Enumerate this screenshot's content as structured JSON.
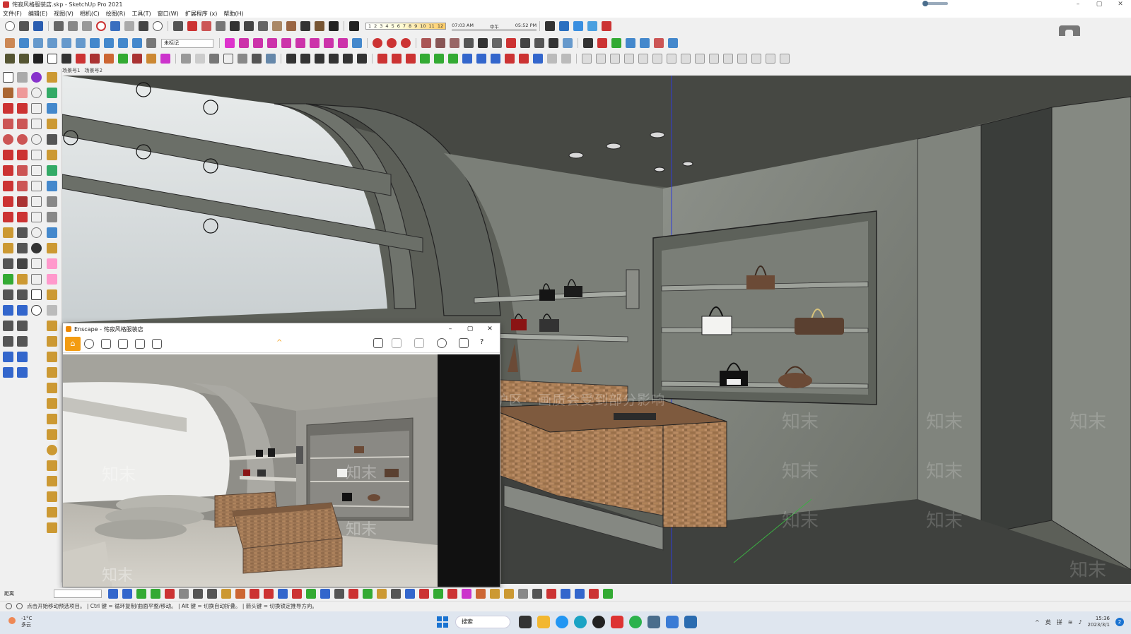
{
  "window": {
    "title": "侘寂风格服装店.skp - SketchUp Pro 2021",
    "controls": [
      "–",
      "▢",
      "✕"
    ]
  },
  "menu": [
    "文件(F)",
    "编辑(E)",
    "视图(V)",
    "相机(C)",
    "绘图(R)",
    "工具(T)",
    "窗口(W)",
    "扩展程序 (x)",
    "帮助(H)"
  ],
  "timeline": {
    "months": [
      "1",
      "2",
      "3",
      "4",
      "5",
      "6",
      "7",
      "8",
      "9",
      "10",
      "11",
      "12"
    ],
    "time_start": "07:03 AM",
    "time_mid": "中午",
    "time_end": "05:52 PM"
  },
  "tag_select": "未标记",
  "scene_tabs": [
    "场景号1",
    "场景号2"
  ],
  "viewport": {
    "watermark_banner": "水印保护区 · 画质会受到部分影响",
    "watermark_text": "知末"
  },
  "enscape": {
    "title": "Enscape - 侘寂风格服装店",
    "home_icon": "⌂",
    "help": "?",
    "controls": [
      "–",
      "▢",
      "✕"
    ]
  },
  "bottom": {
    "distance_label": "距离"
  },
  "status": {
    "hint": "点击开始移动预选项目。 | Ctrl 键 = 循环复制/曲面平整/移动。 | Alt 键 = 切换自动折叠。 | 箭头键 = 切换锁定推导方向。"
  },
  "taskbar": {
    "weather_temp": "-1°C",
    "weather_desc": "多云",
    "search": "搜索",
    "ime_lang": "英",
    "ime_mode": "拼",
    "time": "15:36",
    "date": "2023/3/1",
    "notifications": "2"
  },
  "colors": {
    "toolbar_bg": "#f0f0f0",
    "accent_orange": "#f39c12",
    "taskbar_bg": "#dfe6ef",
    "wall_gray": "#7d817a"
  }
}
